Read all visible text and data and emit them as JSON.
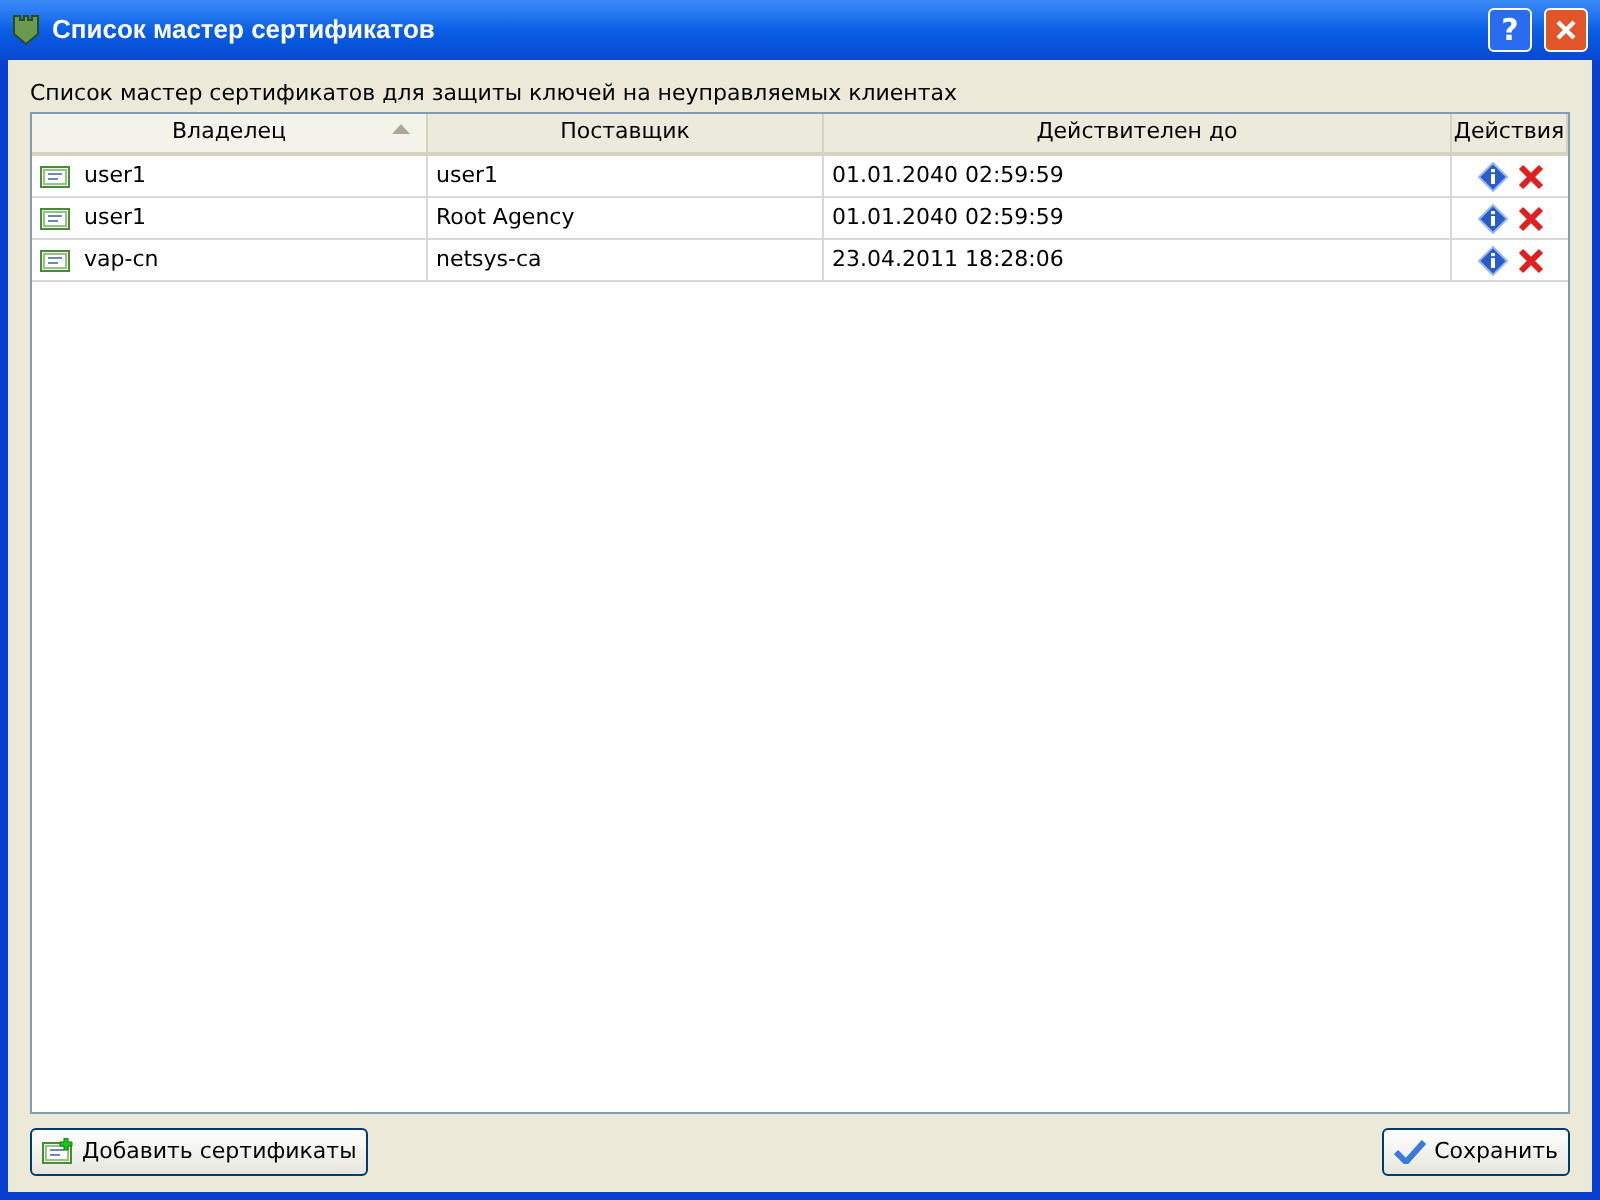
{
  "window": {
    "title": "Список мастер сертификатов",
    "help_button": "?"
  },
  "description": "Список мастер сертификатов для защиты ключей на неуправляемых клиентах",
  "table": {
    "columns": [
      {
        "label": "Владелец",
        "sorted": true
      },
      {
        "label": "Поставщик",
        "sorted": false
      },
      {
        "label": "Действителен до",
        "sorted": false
      },
      {
        "label": "Действия",
        "sorted": false
      }
    ],
    "rows": [
      {
        "owner": "user1",
        "issuer": "user1",
        "valid_until": "01.01.2040 02:59:59"
      },
      {
        "owner": "user1",
        "issuer": "Root Agency",
        "valid_until": "01.01.2040 02:59:59"
      },
      {
        "owner": "vap-cn",
        "issuer": "netsys-ca",
        "valid_until": "23.04.2011 18:28:06"
      }
    ]
  },
  "buttons": {
    "add": "Добавить сертификаты",
    "save": "Сохранить"
  }
}
